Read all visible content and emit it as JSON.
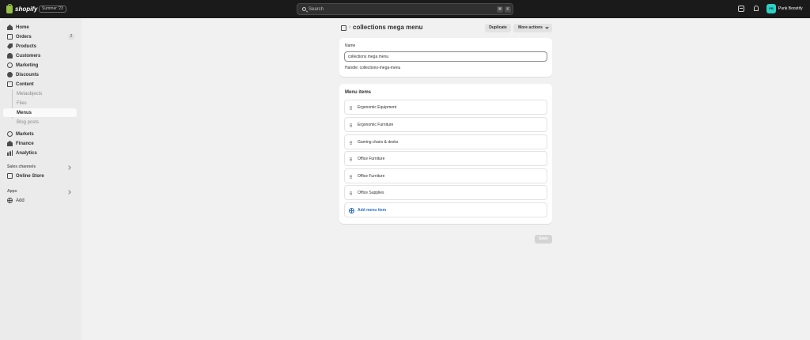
{
  "topbar": {
    "logo_text": "shopify",
    "edition": "Summer '23",
    "search_placeholder": "Search",
    "shortcut_keys": [
      "⌘",
      "K"
    ],
    "user_initials": "PB",
    "user_name": "Punk Boostify"
  },
  "sidebar": {
    "items": [
      {
        "label": "Home"
      },
      {
        "label": "Orders",
        "badge": "2"
      },
      {
        "label": "Products"
      },
      {
        "label": "Customers"
      },
      {
        "label": "Marketing"
      },
      {
        "label": "Discounts"
      },
      {
        "label": "Content"
      }
    ],
    "content_sub": [
      {
        "label": "Metaobjects"
      },
      {
        "label": "Files"
      },
      {
        "label": "Menus"
      },
      {
        "label": "Blog posts"
      }
    ],
    "items2": [
      {
        "label": "Markets"
      },
      {
        "label": "Finance"
      },
      {
        "label": "Analytics"
      }
    ],
    "sales_channels_label": "Sales channels",
    "online_store_label": "Online Store",
    "apps_label": "Apps",
    "add_label": "Add"
  },
  "page": {
    "title": "collections mega menu",
    "breadcrumb_sep": "›",
    "duplicate_label": "Duplicate",
    "more_actions_label": "More actions"
  },
  "name_card": {
    "label": "Name",
    "value": "collections mega menu",
    "handle_text": "Handle: collections-mega-menu"
  },
  "menu_card": {
    "title": "Menu items",
    "items": [
      {
        "label": "Ergonomic Equipment"
      },
      {
        "label": "Ergonomic Furniture"
      },
      {
        "label": "Gaming chairs & desks"
      },
      {
        "label": "Office Furniture"
      },
      {
        "label": "Office Furniture"
      },
      {
        "label": "Office Supplies"
      }
    ],
    "add_label": "Add menu item"
  },
  "save_label": "Save"
}
